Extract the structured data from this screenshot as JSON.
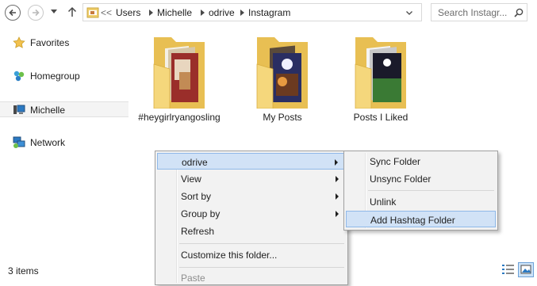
{
  "address": {
    "overflow": "<<",
    "crumbs": [
      "Users",
      "Michelle",
      "odrive",
      "Instagram"
    ]
  },
  "search": {
    "placeholder": "Search Instagr..."
  },
  "sidebar": {
    "items": [
      {
        "label": "Favorites",
        "icon": "star-icon"
      },
      {
        "label": "Homegroup",
        "icon": "homegroup-icon"
      },
      {
        "label": "Michelle",
        "icon": "computer-icon"
      },
      {
        "label": "Network",
        "icon": "network-icon"
      }
    ]
  },
  "folders": [
    {
      "name": "#heygirlryangosling"
    },
    {
      "name": "My Posts"
    },
    {
      "name": "Posts I Liked"
    }
  ],
  "context_menu": {
    "items": [
      {
        "label": "odrive",
        "has_submenu": true,
        "highlighted": true
      },
      {
        "label": "View",
        "has_submenu": true
      },
      {
        "label": "Sort by",
        "has_submenu": true
      },
      {
        "label": "Group by",
        "has_submenu": true
      },
      {
        "label": "Refresh"
      },
      {
        "label": "Customize this folder..."
      },
      {
        "label": "Paste",
        "disabled": true
      }
    ]
  },
  "submenu": {
    "items": [
      {
        "label": "Sync Folder"
      },
      {
        "label": "Unsync Folder"
      },
      {
        "label": "Unlink"
      },
      {
        "label": "Add Hashtag Folder",
        "highlighted": true
      }
    ]
  },
  "status": {
    "item_count": "3 items"
  },
  "colors": {
    "highlight": "#d1e2f6",
    "highlight_border": "#8fb8e8",
    "folder": "#f0cf6c"
  }
}
